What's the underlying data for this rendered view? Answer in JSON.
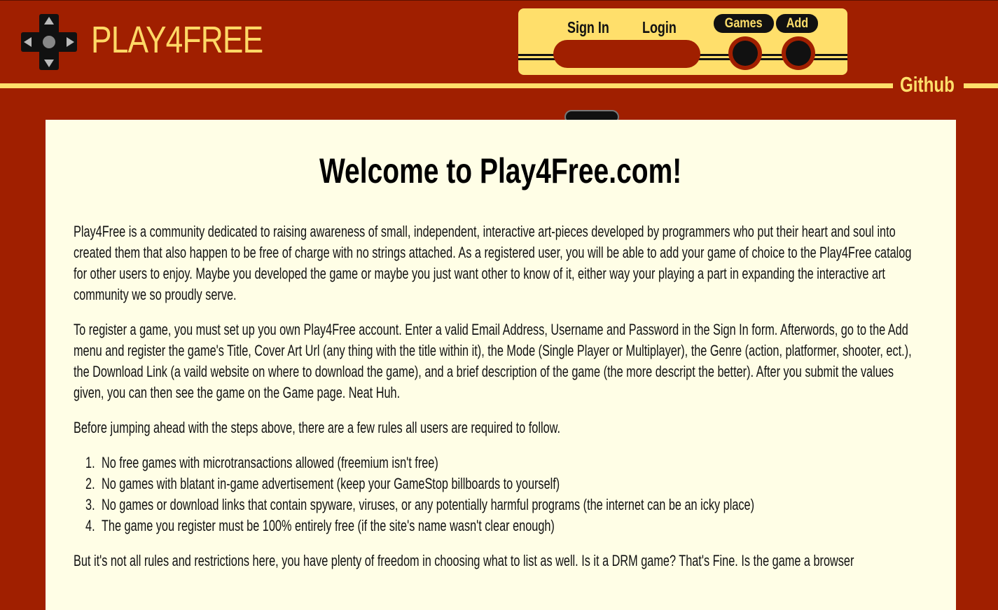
{
  "header": {
    "brand": "PLAY4FREE",
    "nav": {
      "sign_in": "Sign In",
      "login": "Login",
      "games": "Games",
      "add": "Add"
    },
    "github": "Github"
  },
  "main": {
    "title": "Welcome to Play4Free.com!",
    "paragraphs": [
      "Play4Free is a community dedicated to raising awareness of small, independent, interactive art-pieces developed by programmers who put their heart and soul into created them that also happen to be free of charge with no strings attached. As a registered user, you will be able to add your game of choice to the Play4Free catalog for other users to enjoy. Maybe you developed the game or maybe you just want other to know of it, either way your playing a part in expanding the interactive art community we so proudly serve.",
      "To register a game, you must set up you own Play4Free account. Enter a valid Email Address, Username and Password in the Sign In form. Afterwords, go to the Add menu and register the game's Title, Cover Art Url (any thing with the title within it), the Mode (Single Player or Multiplayer), the Genre (action, platformer, shooter, ect.), the Download Link (a vaild website on where to download the game), and a brief description of the game (the more descript the better). After you submit the values given, you can then see the game on the Game page. Neat Huh.",
      "Before jumping ahead with the steps above, there are a few rules all users are required to follow.",
      "But it's not all rules and restrictions here, you have plenty of freedom in choosing what to list as well. Is it a DRM game? That's Fine. Is the game a browser"
    ],
    "rules": [
      {
        "num": "1.",
        "text": "No free games with microtransactions allowed (freemium isn't free)"
      },
      {
        "num": "2.",
        "text": "No games with blatant in-game advertisement (keep your GameStop billboards to yourself)"
      },
      {
        "num": "3.",
        "text": "No games or download links that contain spyware, viruses, or any potentially harmful programs (the internet can be an icky place)"
      },
      {
        "num": "4.",
        "text": "The game you register must be 100% entirely free (if the site's name wasn't clear enough)"
      }
    ]
  },
  "colors": {
    "background": "#a01f00",
    "accent": "#ffdf6b",
    "card": "#fffee6"
  },
  "icons": {
    "logo": "dpad-icon"
  }
}
